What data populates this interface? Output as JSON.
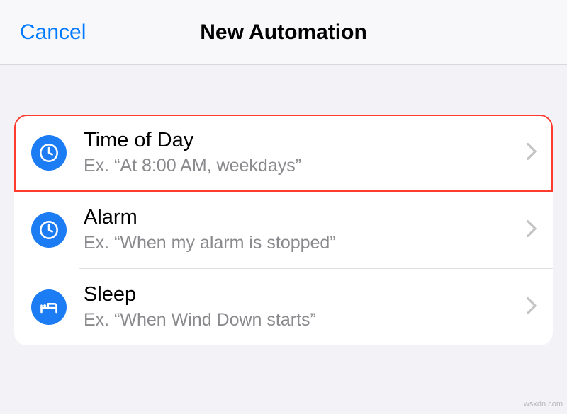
{
  "navbar": {
    "cancel_label": "Cancel",
    "title": "New Automation"
  },
  "triggers": [
    {
      "id": "time-of-day",
      "icon": "clock-icon",
      "title": "Time of Day",
      "subtitle": "Ex. “At 8:00 AM, weekdays”",
      "highlighted": true,
      "color": "#1c7cf3"
    },
    {
      "id": "alarm",
      "icon": "clock-icon",
      "title": "Alarm",
      "subtitle": "Ex. “When my alarm is stopped”",
      "highlighted": false,
      "color": "#1c7cf3"
    },
    {
      "id": "sleep",
      "icon": "bed-icon",
      "title": "Sleep",
      "subtitle": "Ex. “When Wind Down starts”",
      "highlighted": false,
      "color": "#1c7cf3"
    }
  ],
  "watermark": "wsxdn.com"
}
